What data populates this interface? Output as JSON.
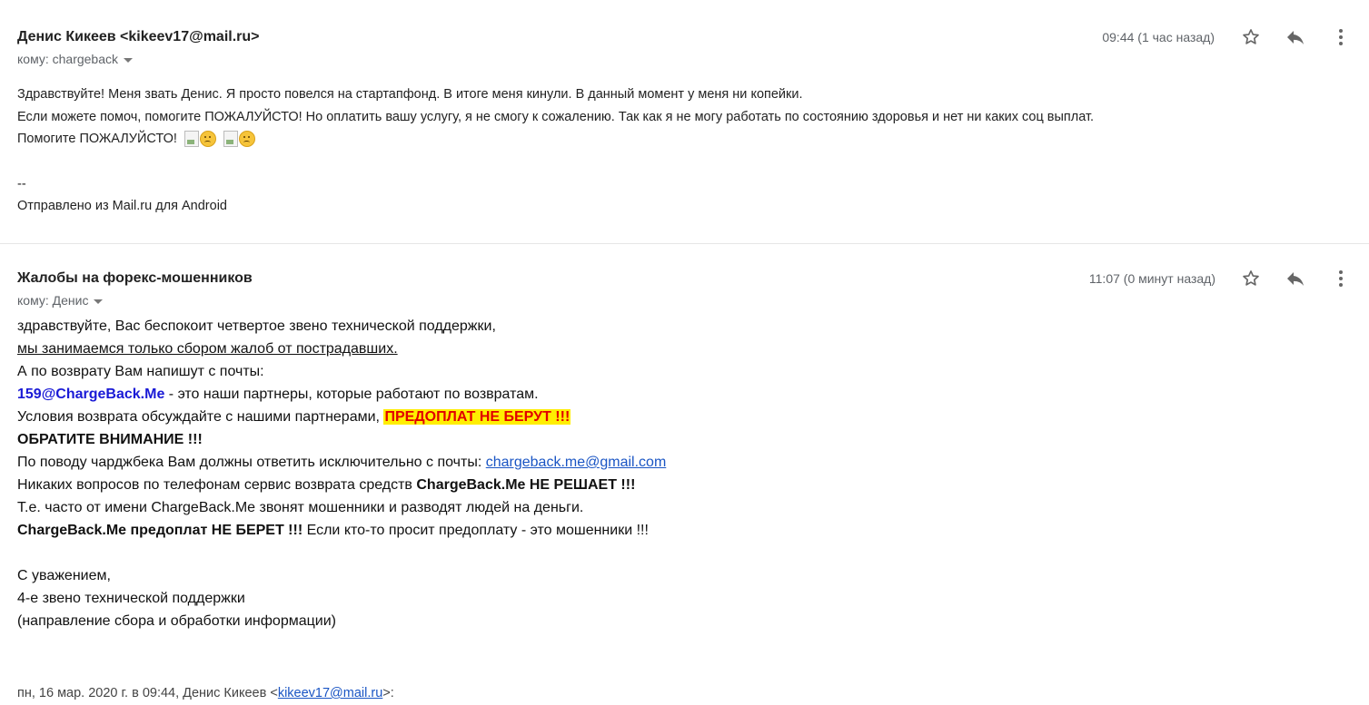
{
  "message1": {
    "sender": "Денис Кикеев <kikeev17@mail.ru>",
    "to": "кому: chargeback",
    "time": "09:44 (1 час назад)",
    "lines": [
      "Здравствуйте! Меня звать Денис. Я просто повелся на стартапфонд. В итоге меня кинули. В данный момент у меня ни копейки.",
      "Если можете помоч, помогите ПОЖАЛУЙСТО! Но оплатить вашу услугу, я не смогу к сожалению. Так как я не могу работать по состоянию здоровья и нет ни каких соц выплат.",
      "Помогите ПОЖАЛУЙСТО!"
    ],
    "sig_dash": "--",
    "sig_text": "Отправлено из Mail.ru для Android"
  },
  "message2": {
    "sender": "Жалобы на форекс-мошенников",
    "to": "кому: Денис",
    "time": "11:07 (0 минут назад)",
    "line1": "здравствуйте, Вас беспокоит четвертое звено технической поддержки,",
    "line2": "мы занимаемся только сбором жалоб от пострадавших.",
    "line3": "А по возврату Вам напишут с почты:",
    "line4_email": "159@ChargeBack.Me",
    "line4_rest": " - это наши партнеры, которые работают по возвратам.",
    "line5_text": "Условия возврата обсуждайте с нашими партнерами, ",
    "line5_highlight": "ПРЕДОПЛАТ НЕ БЕРУТ !!!",
    "line6": "ОБРАТИТЕ ВНИМАНИЕ !!!",
    "line7_text": "По поводу чарджбека Вам должны ответить исключительно с почты: ",
    "line7_link": "chargeback.me@gmail.com",
    "line8_text": "Никаких вопросов по телефонам сервис возврата средств ",
    "line8_bold": "ChargeBack.Me НЕ РЕШАЕТ !!!",
    "line9": "Т.е. часто от имени ChargeBack.Me звонят мошенники и разводят людей на деньги.",
    "line10_bold": "ChargeBack.Me предоплат НЕ БЕРЕТ !!!",
    "line10_rest": " Если кто-то просит предоплату - это мошенники !!!",
    "sign1": "С уважением,",
    "sign2": "4-е звено технической поддержки",
    "sign3": "(направление сбора и обработки информации)",
    "quote_prefix": "пн, 16 мар. 2020 г. в 09:44, Денис Кикеев <",
    "quote_email": "kikeev17@mail.ru",
    "quote_suffix": ">:"
  },
  "icons": {
    "star": "star-icon",
    "reply": "reply-icon",
    "more": "more-vert-icon",
    "caret": "chevron-down-icon"
  },
  "colors": {
    "highlight_bg": "#ffee00",
    "highlight_text": "#e10000",
    "email_blue": "#1a1ad6",
    "link": "#1a55c4"
  }
}
